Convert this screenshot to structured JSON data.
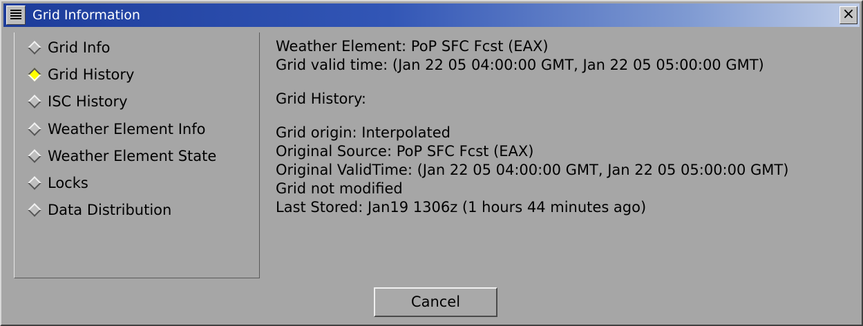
{
  "window": {
    "title": "Grid Information",
    "close_label": "×"
  },
  "sidebar": {
    "items": [
      {
        "label": "Grid Info",
        "selected": false
      },
      {
        "label": "Grid History",
        "selected": true
      },
      {
        "label": "ISC History",
        "selected": false
      },
      {
        "label": "Weather Element Info",
        "selected": false
      },
      {
        "label": "Weather Element State",
        "selected": false
      },
      {
        "label": "Locks",
        "selected": false
      },
      {
        "label": "Data Distribution",
        "selected": false
      }
    ]
  },
  "content": {
    "weather_element": "Weather Element: PoP SFC Fcst (EAX)",
    "valid_time": "Grid valid time: (Jan 22 05 04:00:00 GMT, Jan 22 05 05:00:00 GMT)",
    "history_heading": "Grid History:",
    "grid_origin": "Grid origin: Interpolated",
    "original_source": "Original Source: PoP SFC Fcst (EAX)",
    "original_valid_time": "Original ValidTime: (Jan 22 05 04:00:00 GMT, Jan 22 05 05:00:00 GMT)",
    "modified_status": "Grid not modified",
    "last_stored": "Last Stored: Jan19 1306z (1 hours 44 minutes ago)"
  },
  "buttons": {
    "cancel_label": "Cancel"
  },
  "colors": {
    "background": "#a6a6a6",
    "titlebar_start": "#1d3c9a",
    "titlebar_end": "#bfcde8",
    "selected_radio": "#ffff00"
  }
}
